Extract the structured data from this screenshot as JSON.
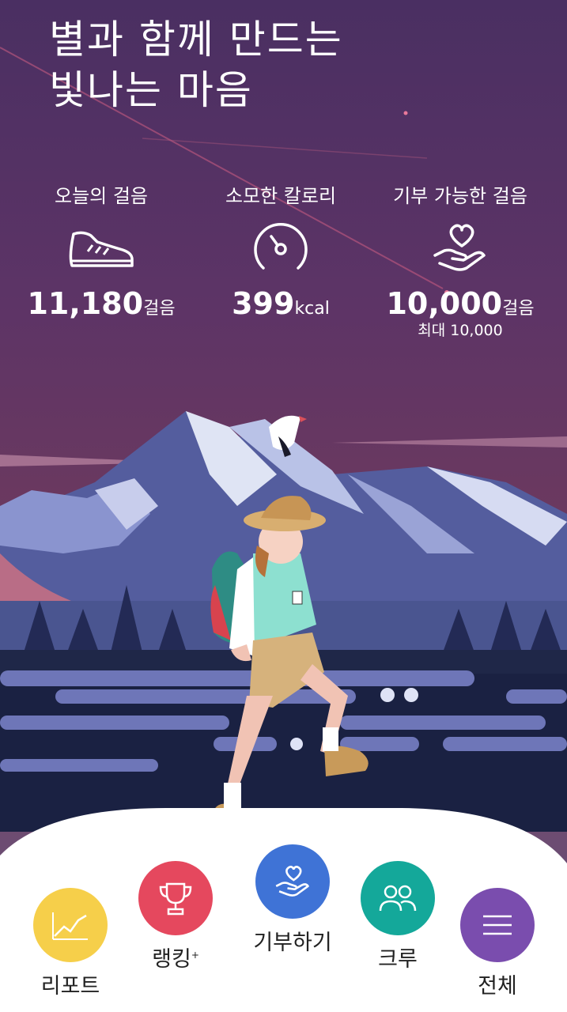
{
  "title": {
    "line1": "별과 함께 만드는",
    "line2": "빛나는 마음"
  },
  "stats": [
    {
      "label": "오늘의 걸음",
      "icon": "sneaker-icon",
      "value": "11,180",
      "unit": "걸음"
    },
    {
      "label": "소모한 칼로리",
      "icon": "gauge-icon",
      "value": "399",
      "unit": "kcal"
    },
    {
      "label": "기부 가능한 걸음",
      "icon": "heart-hand-icon",
      "value": "10,000",
      "unit": "걸음",
      "sub": "최대 10,000"
    }
  ],
  "nav": [
    {
      "label": "리포트",
      "icon": "chart-icon",
      "color": "#f6cf4a"
    },
    {
      "label": "랭킹",
      "sup": "+",
      "icon": "trophy-icon",
      "color": "#e5485e"
    },
    {
      "label": "기부하기",
      "icon": "heart-hand-icon",
      "color": "#3f73d6"
    },
    {
      "label": "크루",
      "icon": "people-icon",
      "color": "#14a89a"
    },
    {
      "label": "전체",
      "icon": "menu-icon",
      "color": "#7a4dae"
    }
  ]
}
